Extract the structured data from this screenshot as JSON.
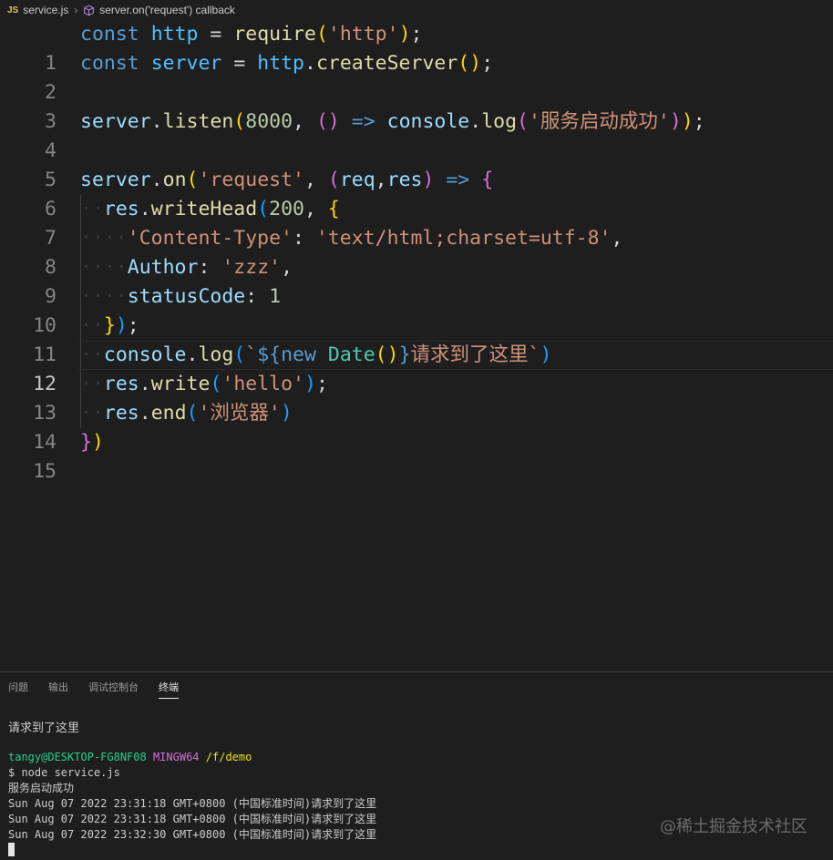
{
  "breadcrumb": {
    "file_icon": "JS",
    "file": "service.js",
    "separator": "›",
    "symbol": "server.on('request') callback"
  },
  "editor": {
    "current_line": 12,
    "lines": [
      {
        "n": "1",
        "text": "const http = require('http');"
      },
      {
        "n": "2",
        "text": "const server = http.createServer();"
      },
      {
        "n": "3",
        "text": ""
      },
      {
        "n": "4",
        "text": "server.listen(8000, () => console.log('服务启动成功'));"
      },
      {
        "n": "5",
        "text": ""
      },
      {
        "n": "6",
        "text": "server.on('request', (req,res) => {"
      },
      {
        "n": "7",
        "text": "  res.writeHead(200, {"
      },
      {
        "n": "8",
        "text": "    'Content-Type': 'text/html;charset=utf-8',"
      },
      {
        "n": "9",
        "text": "    Author: 'zzz',"
      },
      {
        "n": "10",
        "text": "    statusCode: 1"
      },
      {
        "n": "11",
        "text": "  });"
      },
      {
        "n": "12",
        "text": "  console.log(`${new Date()}请求到了这里`)"
      },
      {
        "n": "13",
        "text": "  res.write('hello');"
      },
      {
        "n": "14",
        "text": "  res.end('浏览器')"
      },
      {
        "n": "15",
        "text": "})"
      }
    ]
  },
  "panel": {
    "tabs": [
      "问题",
      "输出",
      "调试控制台",
      "终端"
    ],
    "active_tab": "终端",
    "output_text": "请求到了这里",
    "terminal": {
      "user": "tangy@DESKTOP-FG8NF08",
      "env": "MINGW64",
      "path": "/f/demo",
      "command": "$ node service.js",
      "lines": [
        "服务启动成功",
        "Sun Aug 07 2022 23:31:18 GMT+0800 (中国标准时间)请求到了这里",
        "Sun Aug 07 2022 23:31:18 GMT+0800 (中国标准时间)请求到了这里",
        "Sun Aug 07 2022 23:32:30 GMT+0800 (中国标准时间)请求到了这里"
      ]
    }
  },
  "watermark": "@稀土掘金技术社区",
  "colors": {
    "background": "#1e1e1e",
    "keyword": "#569cd6",
    "string": "#ce9178",
    "function": "#dcdcaa",
    "variable": "#4fc1ff",
    "property": "#9cdcfe",
    "number": "#b5cea8"
  }
}
